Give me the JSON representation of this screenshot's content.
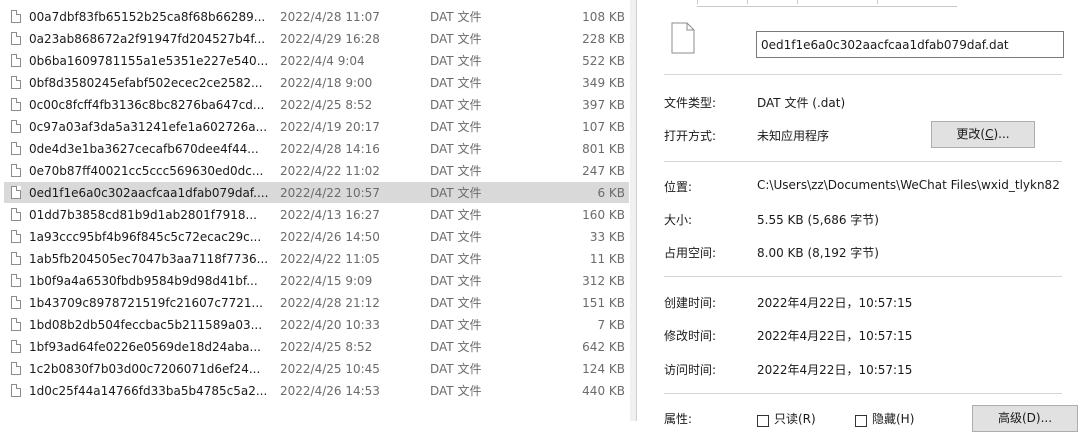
{
  "files": [
    {
      "name": "00a7dbf83fb65152b25ca8f68b66289...",
      "date": "2022/4/28 11:07",
      "type": "DAT 文件",
      "size": "108 KB"
    },
    {
      "name": "0a23ab868672a2f91947fd204527b4f...",
      "date": "2022/4/29 16:28",
      "type": "DAT 文件",
      "size": "228 KB"
    },
    {
      "name": "0b6ba1609781155a1e5351e227e540...",
      "date": "2022/4/4 9:04",
      "type": "DAT 文件",
      "size": "522 KB"
    },
    {
      "name": "0bf8d3580245efabf502ecec2ce2582...",
      "date": "2022/4/18 9:00",
      "type": "DAT 文件",
      "size": "349 KB"
    },
    {
      "name": "0c00c8fcff4fb3136c8bc8276ba647cd...",
      "date": "2022/4/25 8:52",
      "type": "DAT 文件",
      "size": "397 KB"
    },
    {
      "name": "0c97a03af3da5a31241efe1a602726a...",
      "date": "2022/4/19 20:17",
      "type": "DAT 文件",
      "size": "107 KB"
    },
    {
      "name": "0de4d3e1ba3627cecafb670dee4f44...",
      "date": "2022/4/28 14:16",
      "type": "DAT 文件",
      "size": "801 KB"
    },
    {
      "name": "0e70b87ff40021cc5ccc569630ed0dc...",
      "date": "2022/4/22 11:02",
      "type": "DAT 文件",
      "size": "247 KB"
    },
    {
      "name": "0ed1f1e6a0c302aacfcaa1dfab079daf....",
      "date": "2022/4/22 10:57",
      "type": "DAT 文件",
      "size": "6 KB"
    },
    {
      "name": "01dd7b3858cd81b9d1ab2801f7918...",
      "date": "2022/4/13 16:27",
      "type": "DAT 文件",
      "size": "160 KB"
    },
    {
      "name": "1a93ccc95bf4b96f845c5c72ecac29c...",
      "date": "2022/4/26 14:50",
      "type": "DAT 文件",
      "size": "33 KB"
    },
    {
      "name": "1ab5fb204505ec7047b3aa7118f7736...",
      "date": "2022/4/22 11:05",
      "type": "DAT 文件",
      "size": "11 KB"
    },
    {
      "name": "1b0f9a4a6530fbdb9584b9d98d41bf...",
      "date": "2022/4/15 9:09",
      "type": "DAT 文件",
      "size": "312 KB"
    },
    {
      "name": "1b43709c8978721519fc21607c7721...",
      "date": "2022/4/28 21:12",
      "type": "DAT 文件",
      "size": "151 KB"
    },
    {
      "name": "1bd08b2db504feccbac5b211589a03...",
      "date": "2022/4/20 10:33",
      "type": "DAT 文件",
      "size": "7 KB"
    },
    {
      "name": "1bf93ad64fe0226e0569de18d24aba...",
      "date": "2022/4/25 8:52",
      "type": "DAT 文件",
      "size": "642 KB"
    },
    {
      "name": "1c2b0830f7b03d00c7206071d6ef24...",
      "date": "2022/4/25 10:45",
      "type": "DAT 文件",
      "size": "124 KB"
    },
    {
      "name": "1d0c25f44a14766fd33ba5b4785c5a2...",
      "date": "2022/4/26 14:53",
      "type": "DAT 文件",
      "size": "440 KB"
    }
  ],
  "selected_index": 8,
  "properties": {
    "filename": "0ed1f1e6a0c302aacfcaa1dfab079daf.dat",
    "file_type_label": "文件类型:",
    "file_type_value": "DAT 文件 (.dat)",
    "open_with_label": "打开方式:",
    "open_with_value": "未知应用程序",
    "change_button_text": "更改",
    "change_button_key": "C",
    "location_label": "位置:",
    "location_value": "C:\\Users\\zz\\Documents\\WeChat Files\\wxid_tlykn82",
    "size_label": "大小:",
    "size_value": "5.55 KB (5,686 字节)",
    "size_on_disk_label": "占用空间:",
    "size_on_disk_value": "8.00 KB (8,192 字节)",
    "created_label": "创建时间:",
    "created_value": "2022年4月22日，10:57:15",
    "modified_label": "修改时间:",
    "modified_value": "2022年4月22日，10:57:15",
    "accessed_label": "访问时间:",
    "accessed_value": "2022年4月22日，10:57:15",
    "attributes_label": "属性:",
    "readonly_label": "只读(R)",
    "hidden_label": "隐藏(H)",
    "advanced_button": "高级(D)..."
  },
  "icons": {
    "file": "file-icon",
    "big_file": "big-file-icon"
  },
  "colors": {
    "selected_row": "#d9d9d9",
    "secondary_text": "#6b6b6b",
    "button_face": "#e1e1e1"
  }
}
